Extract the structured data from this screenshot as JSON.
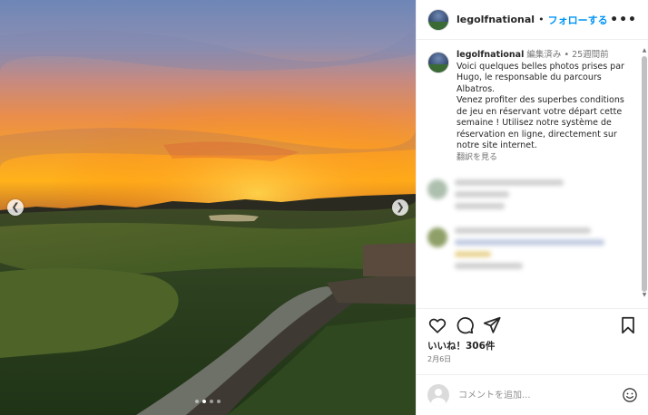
{
  "post": {
    "username": "legolfnational",
    "follow_label": "フォローする",
    "separator": "•",
    "more_label": "•••"
  },
  "caption": {
    "username": "legolfnational",
    "edited_label": "編集済み",
    "separator": "•",
    "time_ago": "25週間前",
    "text": "Voici quelques belles photos prises par Hugo, le responsable du parcours Albatros.\nVenez profiter des superbes conditions de jeu en réservant votre départ cette semaine ! Utilisez notre système de réservation en ligne, directement sur notre site internet.",
    "translate_label": "翻訳を見る"
  },
  "footer": {
    "likes_text": "いいね！306件",
    "date_text": "2月6日"
  },
  "comment_box": {
    "placeholder": "コメントを追加..."
  },
  "carousel": {
    "prev_icon": "chevron-left-icon",
    "next_icon": "chevron-right-icon",
    "slide_count": 4,
    "active_slide": 2
  },
  "icons": {
    "like": "heart-icon",
    "comment": "comment-icon",
    "share": "paper-plane-icon",
    "save": "bookmark-icon",
    "emoji": "smiley-icon"
  },
  "colors": {
    "accent": "#0095f6",
    "text": "#262626",
    "muted": "#737373",
    "border": "#efefef"
  }
}
